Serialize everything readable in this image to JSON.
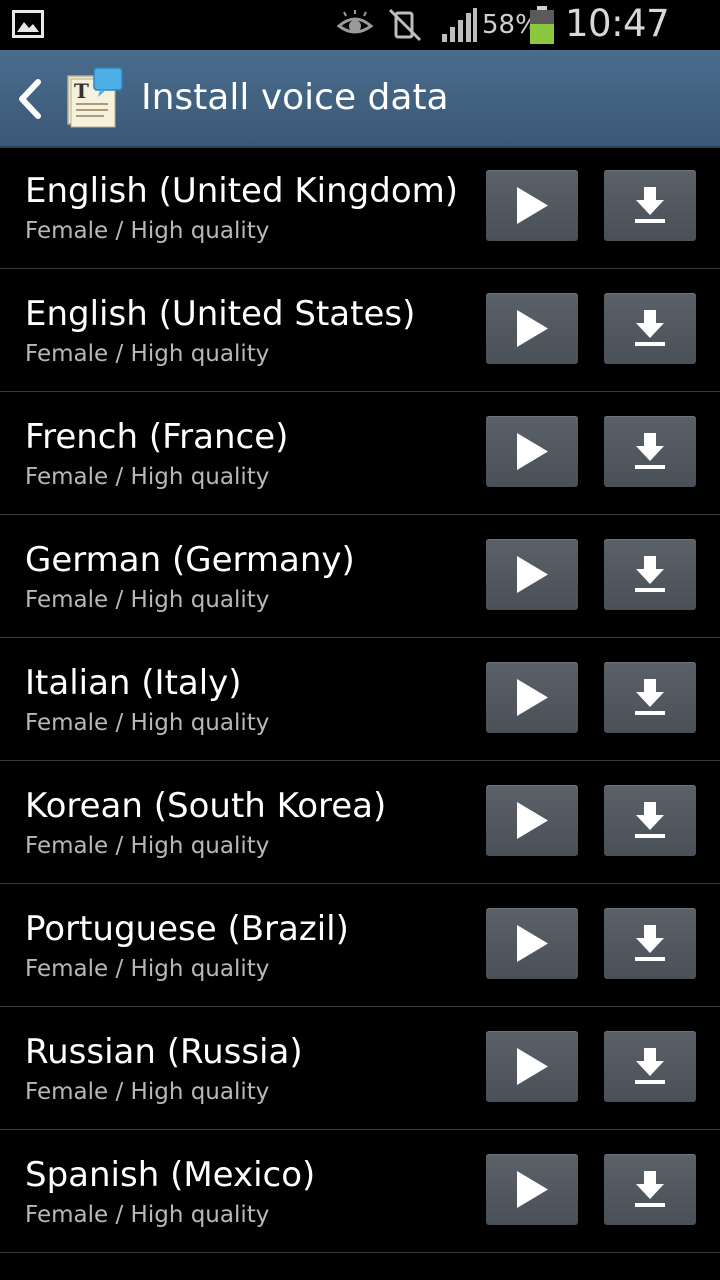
{
  "status_bar": {
    "battery_percent": "58%",
    "time": "10:47 PM",
    "icons": [
      "gallery-icon",
      "eye-icon",
      "mute-icon",
      "signal-icon",
      "battery-icon"
    ],
    "battery_color": "#8dc63f"
  },
  "action_bar": {
    "title": "Install voice data",
    "background": "#3f607f"
  },
  "voices": [
    {
      "language": "English (United Kingdom)",
      "detail": "Female / High quality"
    },
    {
      "language": "English (United States)",
      "detail": "Female / High quality"
    },
    {
      "language": "French (France)",
      "detail": "Female / High quality"
    },
    {
      "language": "German (Germany)",
      "detail": "Female / High quality"
    },
    {
      "language": "Italian (Italy)",
      "detail": "Female / High quality"
    },
    {
      "language": "Korean (South Korea)",
      "detail": "Female / High quality"
    },
    {
      "language": "Portuguese (Brazil)",
      "detail": "Female / High quality"
    },
    {
      "language": "Russian (Russia)",
      "detail": "Female / High quality"
    },
    {
      "language": "Spanish (Mexico)",
      "detail": "Female / High quality"
    }
  ]
}
